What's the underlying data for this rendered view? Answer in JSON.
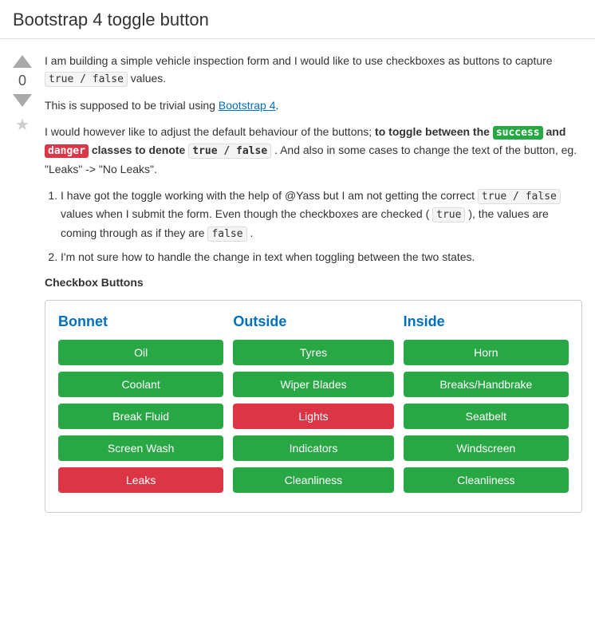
{
  "page": {
    "title": "Bootstrap 4 toggle button"
  },
  "vote": {
    "count": "0"
  },
  "content": {
    "para1": "I am building a simple vehicle inspection form and I would like to use checkboxes as buttons to capture ",
    "para1_code": "true / false",
    "para1_end": " values.",
    "para2_start": "This is supposed to be trivial using ",
    "para2_link": "Bootstrap 4",
    "para2_end": ".",
    "para3_start": "I would however like to adjust the default behaviour of the buttons; ",
    "para3_bold_start": "to toggle between the ",
    "para3_success": "success",
    "para3_bold_middle": " and ",
    "para3_danger": "danger",
    "para3_bold_end": " classes to denote ",
    "para3_code": "true / false",
    "para3_period": " . And also in some cases to change the text of the button, eg. \"Leaks\" -> \"No Leaks\".",
    "list_item1_start": "I have got the toggle working with the help of @Yass but I am not getting the correct ",
    "list_item1_code": "true / false",
    "list_item1_mid": " values when I submit the form. Even though the checkboxes are checked ( ",
    "list_item1_code2": "true",
    "list_item1_end": " ), the values are coming through as if they are ",
    "list_item1_code3": "false",
    "list_item1_period": " .",
    "list_item2": "I'm not sure how to handle the change in text when toggling between the two states.",
    "section_label": "Checkbox Buttons"
  },
  "columns": {
    "bonnet": {
      "header": "Bonnet",
      "buttons": [
        {
          "label": "Oil",
          "state": "success"
        },
        {
          "label": "Coolant",
          "state": "success"
        },
        {
          "label": "Break Fluid",
          "state": "success"
        },
        {
          "label": "Screen Wash",
          "state": "success"
        },
        {
          "label": "Leaks",
          "state": "danger"
        }
      ]
    },
    "outside": {
      "header": "Outside",
      "buttons": [
        {
          "label": "Tyres",
          "state": "success"
        },
        {
          "label": "Wiper Blades",
          "state": "success"
        },
        {
          "label": "Lights",
          "state": "danger"
        },
        {
          "label": "Indicators",
          "state": "success"
        },
        {
          "label": "Cleanliness",
          "state": "success"
        }
      ]
    },
    "inside": {
      "header": "Inside",
      "buttons": [
        {
          "label": "Horn",
          "state": "success"
        },
        {
          "label": "Breaks/Handbrake",
          "state": "success"
        },
        {
          "label": "Seatbelt",
          "state": "success"
        },
        {
          "label": "Windscreen",
          "state": "success"
        },
        {
          "label": "Cleanliness",
          "state": "success"
        }
      ]
    }
  }
}
